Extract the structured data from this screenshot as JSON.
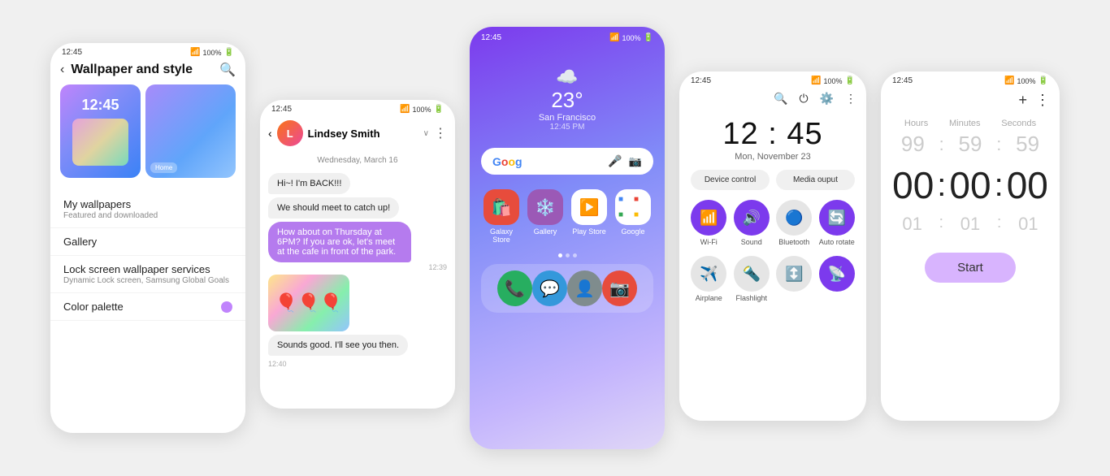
{
  "phone1": {
    "status_time": "12:45",
    "title": "Wallpaper and style",
    "wp_time": "12:45",
    "menu": [
      {
        "label": "My wallpapers",
        "sub": "Featured and downloaded"
      },
      {
        "label": "Gallery",
        "sub": ""
      },
      {
        "label": "Lock screen wallpaper services",
        "sub": "Dynamic Lock screen, Samsung Global Goals"
      },
      {
        "label": "Color palette",
        "sub": ""
      }
    ]
  },
  "phone2": {
    "status_time": "12:45",
    "contact": "Lindsey Smith",
    "date_divider": "Wednesday, March 16",
    "messages": [
      {
        "text": "Hi~! I'm BACK!!!",
        "side": "left",
        "time": ""
      },
      {
        "text": "We should meet to catch up!",
        "side": "left",
        "time": ""
      },
      {
        "text": "How about on Thursday at 6PM? If you are ok, let's meet at the cafe in front of the park.",
        "side": "right",
        "time": "12:39"
      },
      {
        "text": "balloon_image",
        "side": "left",
        "time": ""
      },
      {
        "text": "Sounds good. I'll see you then.",
        "side": "left",
        "time": "12:40"
      }
    ]
  },
  "phone3": {
    "status_time": "12:45",
    "weather_temp": "23°",
    "weather_city": "San Francisco",
    "weather_time": "12:45 PM",
    "apps_row1": [
      {
        "label": "Galaxy Store",
        "emoji": "🛍️",
        "bg": "#e74c3c"
      },
      {
        "label": "Gallery",
        "emoji": "❄️",
        "bg": "#9b59b6"
      },
      {
        "label": "Play Store",
        "emoji": "▶️",
        "bg": "#ecf0f1"
      },
      {
        "label": "Google",
        "emoji": "⊞",
        "bg": "#ecf0f1"
      }
    ],
    "dock_apps": [
      {
        "emoji": "📞",
        "bg": "#27ae60"
      },
      {
        "emoji": "💬",
        "bg": "#3498db"
      },
      {
        "emoji": "👤",
        "bg": "#7f8c8d"
      },
      {
        "emoji": "📷",
        "bg": "#e74c3c"
      }
    ]
  },
  "phone4": {
    "status_time": "12:45",
    "clock_time": "12 : 45",
    "clock_date": "Mon, November 23",
    "device_control": "Device control",
    "media_output": "Media ouput",
    "toggles": [
      {
        "label": "Wi-Fi",
        "icon": "📶",
        "on": true
      },
      {
        "label": "Sound",
        "icon": "🔊",
        "on": true
      },
      {
        "label": "Bluetooth",
        "icon": "🔵",
        "on": false
      },
      {
        "label": "Auto rotate",
        "icon": "🔄",
        "on": true
      }
    ],
    "toggles2": [
      {
        "label": "Airplane",
        "icon": "✈️",
        "on": false
      },
      {
        "label": "Flashlight",
        "icon": "🔦",
        "on": false
      },
      {
        "label": "",
        "icon": "↕️",
        "on": false
      },
      {
        "label": "",
        "icon": "📡",
        "on": true
      }
    ]
  },
  "phone5": {
    "status_time": "12:45",
    "labels": [
      "Hours",
      "Minutes",
      "Seconds"
    ],
    "top_nums": [
      "99",
      "59",
      "59"
    ],
    "main_time": [
      "00",
      "00",
      "00"
    ],
    "bottom_nums": [
      "01",
      "01",
      "01"
    ],
    "start_label": "Start",
    "plus_icon": "+",
    "more_icon": "⋮"
  }
}
